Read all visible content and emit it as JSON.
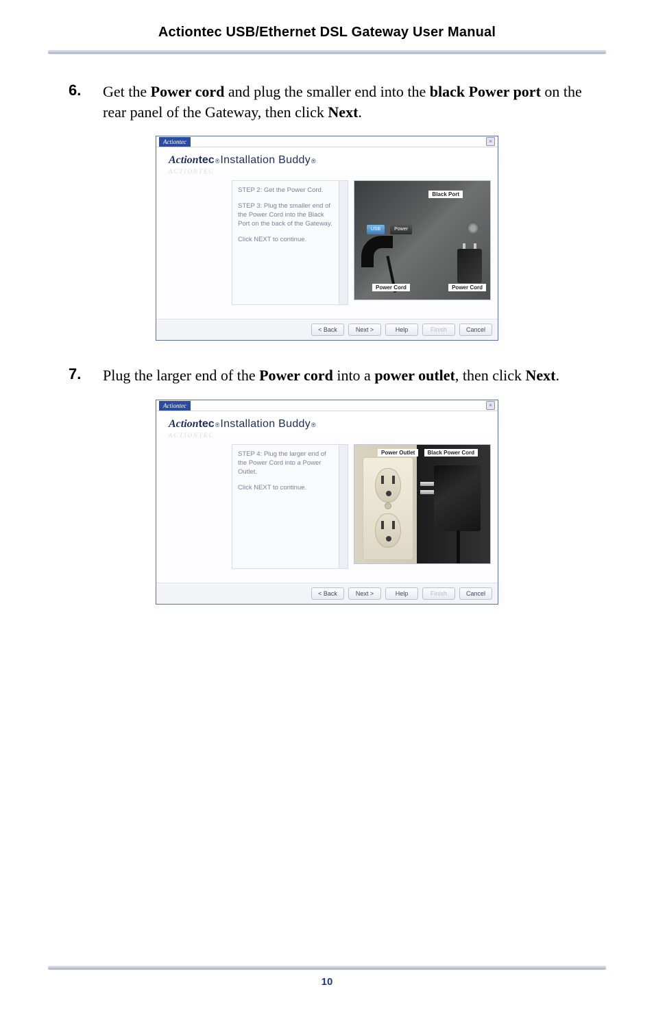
{
  "header": {
    "title": "Actiontec USB/Ethernet DSL Gateway User Manual"
  },
  "steps": [
    {
      "number": "6.",
      "pre": "Get the ",
      "b1": "Power cord",
      "mid1": " and plug the smaller end into the ",
      "b2": "black Power port",
      "mid2": " on the rear panel of the Gateway, then click ",
      "b3": "Next",
      "post": "."
    },
    {
      "number": "7.",
      "pre": "Plug the larger end of the ",
      "b1": "Power cord",
      "mid1": " into a ",
      "b2": "power outlet",
      "mid2": ", then click ",
      "b3": "Next",
      "post": "."
    }
  ],
  "dialog": {
    "badge": "Actiontec",
    "close": "×",
    "brand_italic": "Action",
    "brand_bold": "tec",
    "brand_reg": "®",
    "brand_rest": " Installation Buddy",
    "brand_reg2": "®",
    "underlay": "ACTIONTEC",
    "scroll_up": "▲",
    "scroll_dn": "▼",
    "buttons": {
      "back": "< Back",
      "next": "Next >",
      "help": "Help",
      "finish": "Finish",
      "cancel": "Cancel"
    }
  },
  "panel_a": {
    "p1": "STEP 2:  Get the Power Cord.",
    "p2": "STEP 3:  Plug the smaller end of the Power Cord into the Black Port on the back of the Gateway.",
    "p3": "Click NEXT to continue.",
    "labels": {
      "black_port": "Black Port",
      "usb": "USB",
      "power": "Power",
      "power_cord": "Power Cord",
      "power_cord2": "Power Cord"
    }
  },
  "panel_b": {
    "p1": "STEP 4:  Plug the larger end of the Power Cord into a Power Outlet.",
    "p3": "Click NEXT to continue.",
    "labels": {
      "outlet": "Power Outlet",
      "bpcord": "Black Power Cord"
    }
  },
  "page_number": "10"
}
